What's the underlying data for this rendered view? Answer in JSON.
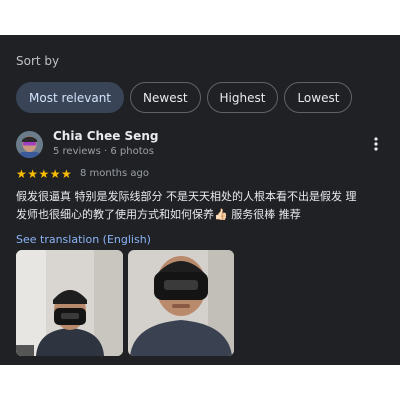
{
  "sort": {
    "label": "Sort by",
    "options": [
      "Most relevant",
      "Newest",
      "Highest",
      "Lowest"
    ],
    "selected": "Most relevant"
  },
  "review": {
    "reviewer_name": "Chia Chee Seng",
    "reviewer_meta": "5 reviews · 6 photos",
    "rating": 5,
    "stars_text": "★★★★★",
    "time_ago": "8 months ago",
    "text_line1": "假发很逼真 特别是发际线部分 不是天天相处的人根本看不出是假发 理",
    "text_line2": "发师也很细心的教了使用方式和如何保养👍🏻 服务很棒 推荐",
    "see_translation": "See translation (English)",
    "photo_count": 2
  },
  "colors": {
    "background": "#202124",
    "accent_chip": "#394457",
    "link": "#8ab4f8",
    "star": "#fbbc04"
  },
  "icons": {
    "more": "more-vert-icon",
    "star": "star-icon"
  }
}
